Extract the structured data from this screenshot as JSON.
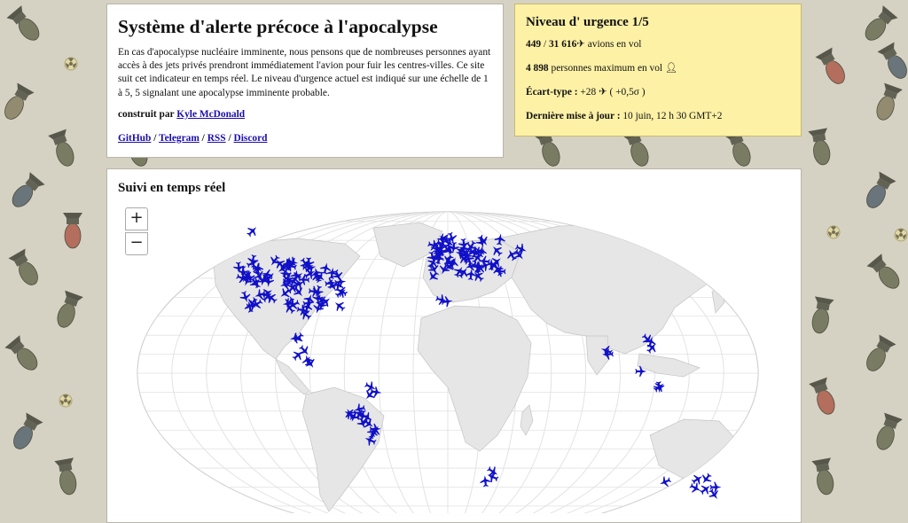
{
  "intro": {
    "title": "Système d'alerte précoce à l'apocalypse",
    "description": "En cas d'apocalypse nucléaire imminente, nous pensons que de nombreuses personnes ayant accès à des jets privés prendront immédiatement l'avion pour fuir les centres-villes. Ce site suit cet indicateur en temps réel. Le niveau d'urgence actuel est indiqué sur une échelle de 1 à 5, 5 signalant une apocalypse imminente probable.",
    "built_by_label": "construit par",
    "author": "Kyle McDonald",
    "links": [
      "GitHub",
      "Telegram",
      "RSS",
      "Discord"
    ],
    "link_separator": "/"
  },
  "urgency": {
    "title": "Niveau d' urgence 1/5",
    "planes_in_flight": "449",
    "planes_total": "31 616",
    "planes_label": "avions en vol",
    "max_people": "4 898",
    "max_people_label": "personnes maximum en vol",
    "stddev_label": "Écart-type :",
    "stddev_value": "+28",
    "stddev_sigma": "( +0,5σ )",
    "last_update_label": "Dernière mise à jour :",
    "last_update_value": "10 juin, 12 h 30 GMT+2"
  },
  "tracking": {
    "title": "Suivi en temps réel",
    "zoom_in": "+",
    "zoom_out": "−"
  },
  "icons": {
    "plane": "airplane-icon",
    "person": "person-icon",
    "background": [
      "bomb-icon",
      "radiation-icon"
    ]
  },
  "colors": {
    "plane": "#1010c8",
    "urgency_background": "#fdf1a6",
    "page_background": "#d6d2c3",
    "link": "#1a0dab"
  }
}
